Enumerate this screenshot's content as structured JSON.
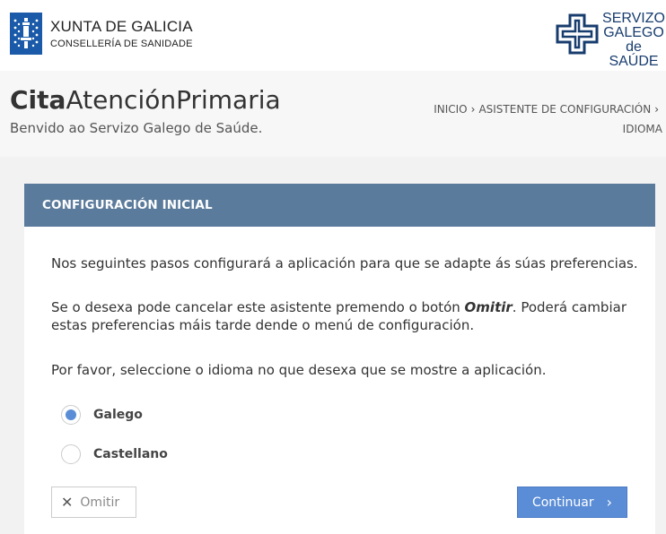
{
  "brand": {
    "xunta_title": "XUNTA DE GALICIA",
    "xunta_subtitle": "CONSELLERÍA DE SANIDADE",
    "sergas_line1": "SERVIZO",
    "sergas_line2": "GALEGO",
    "sergas_line3": "de SAÚDE",
    "colors": {
      "xunta_blue": "#1a5aa8",
      "sergas_navy": "#173c6e"
    }
  },
  "header": {
    "title_bold": "Cita",
    "title_light": "AtenciónPrimaria",
    "subtitle": "Benvido ao Servizo Galego de Saúde.",
    "breadcrumb": [
      "INICIO",
      "ASISTENTE DE CONFIGURACIÓN",
      "IDIOMA"
    ]
  },
  "panel": {
    "heading": "CONFIGURACIÓN INICIAL",
    "para1": "Nos seguintes pasos configurará a aplicación para que se adapte ás súas preferencias.",
    "para2_before": "Se o desexa pode cancelar este asistente premendo o botón ",
    "para2_em": "Omitir",
    "para2_after": ". Poderá cambiar estas preferencias máis tarde dende o menú de configuración.",
    "para3": "Por favor, seleccione o idioma no que desexa que se mostre a aplicación.",
    "languages": [
      {
        "label": "Galego",
        "selected": true
      },
      {
        "label": "Castellano",
        "selected": false
      }
    ],
    "omit_label": "Omitir",
    "continue_label": "Continuar",
    "colors": {
      "header_bg": "#5b7b9c",
      "accent": "#5b8dd6"
    }
  }
}
